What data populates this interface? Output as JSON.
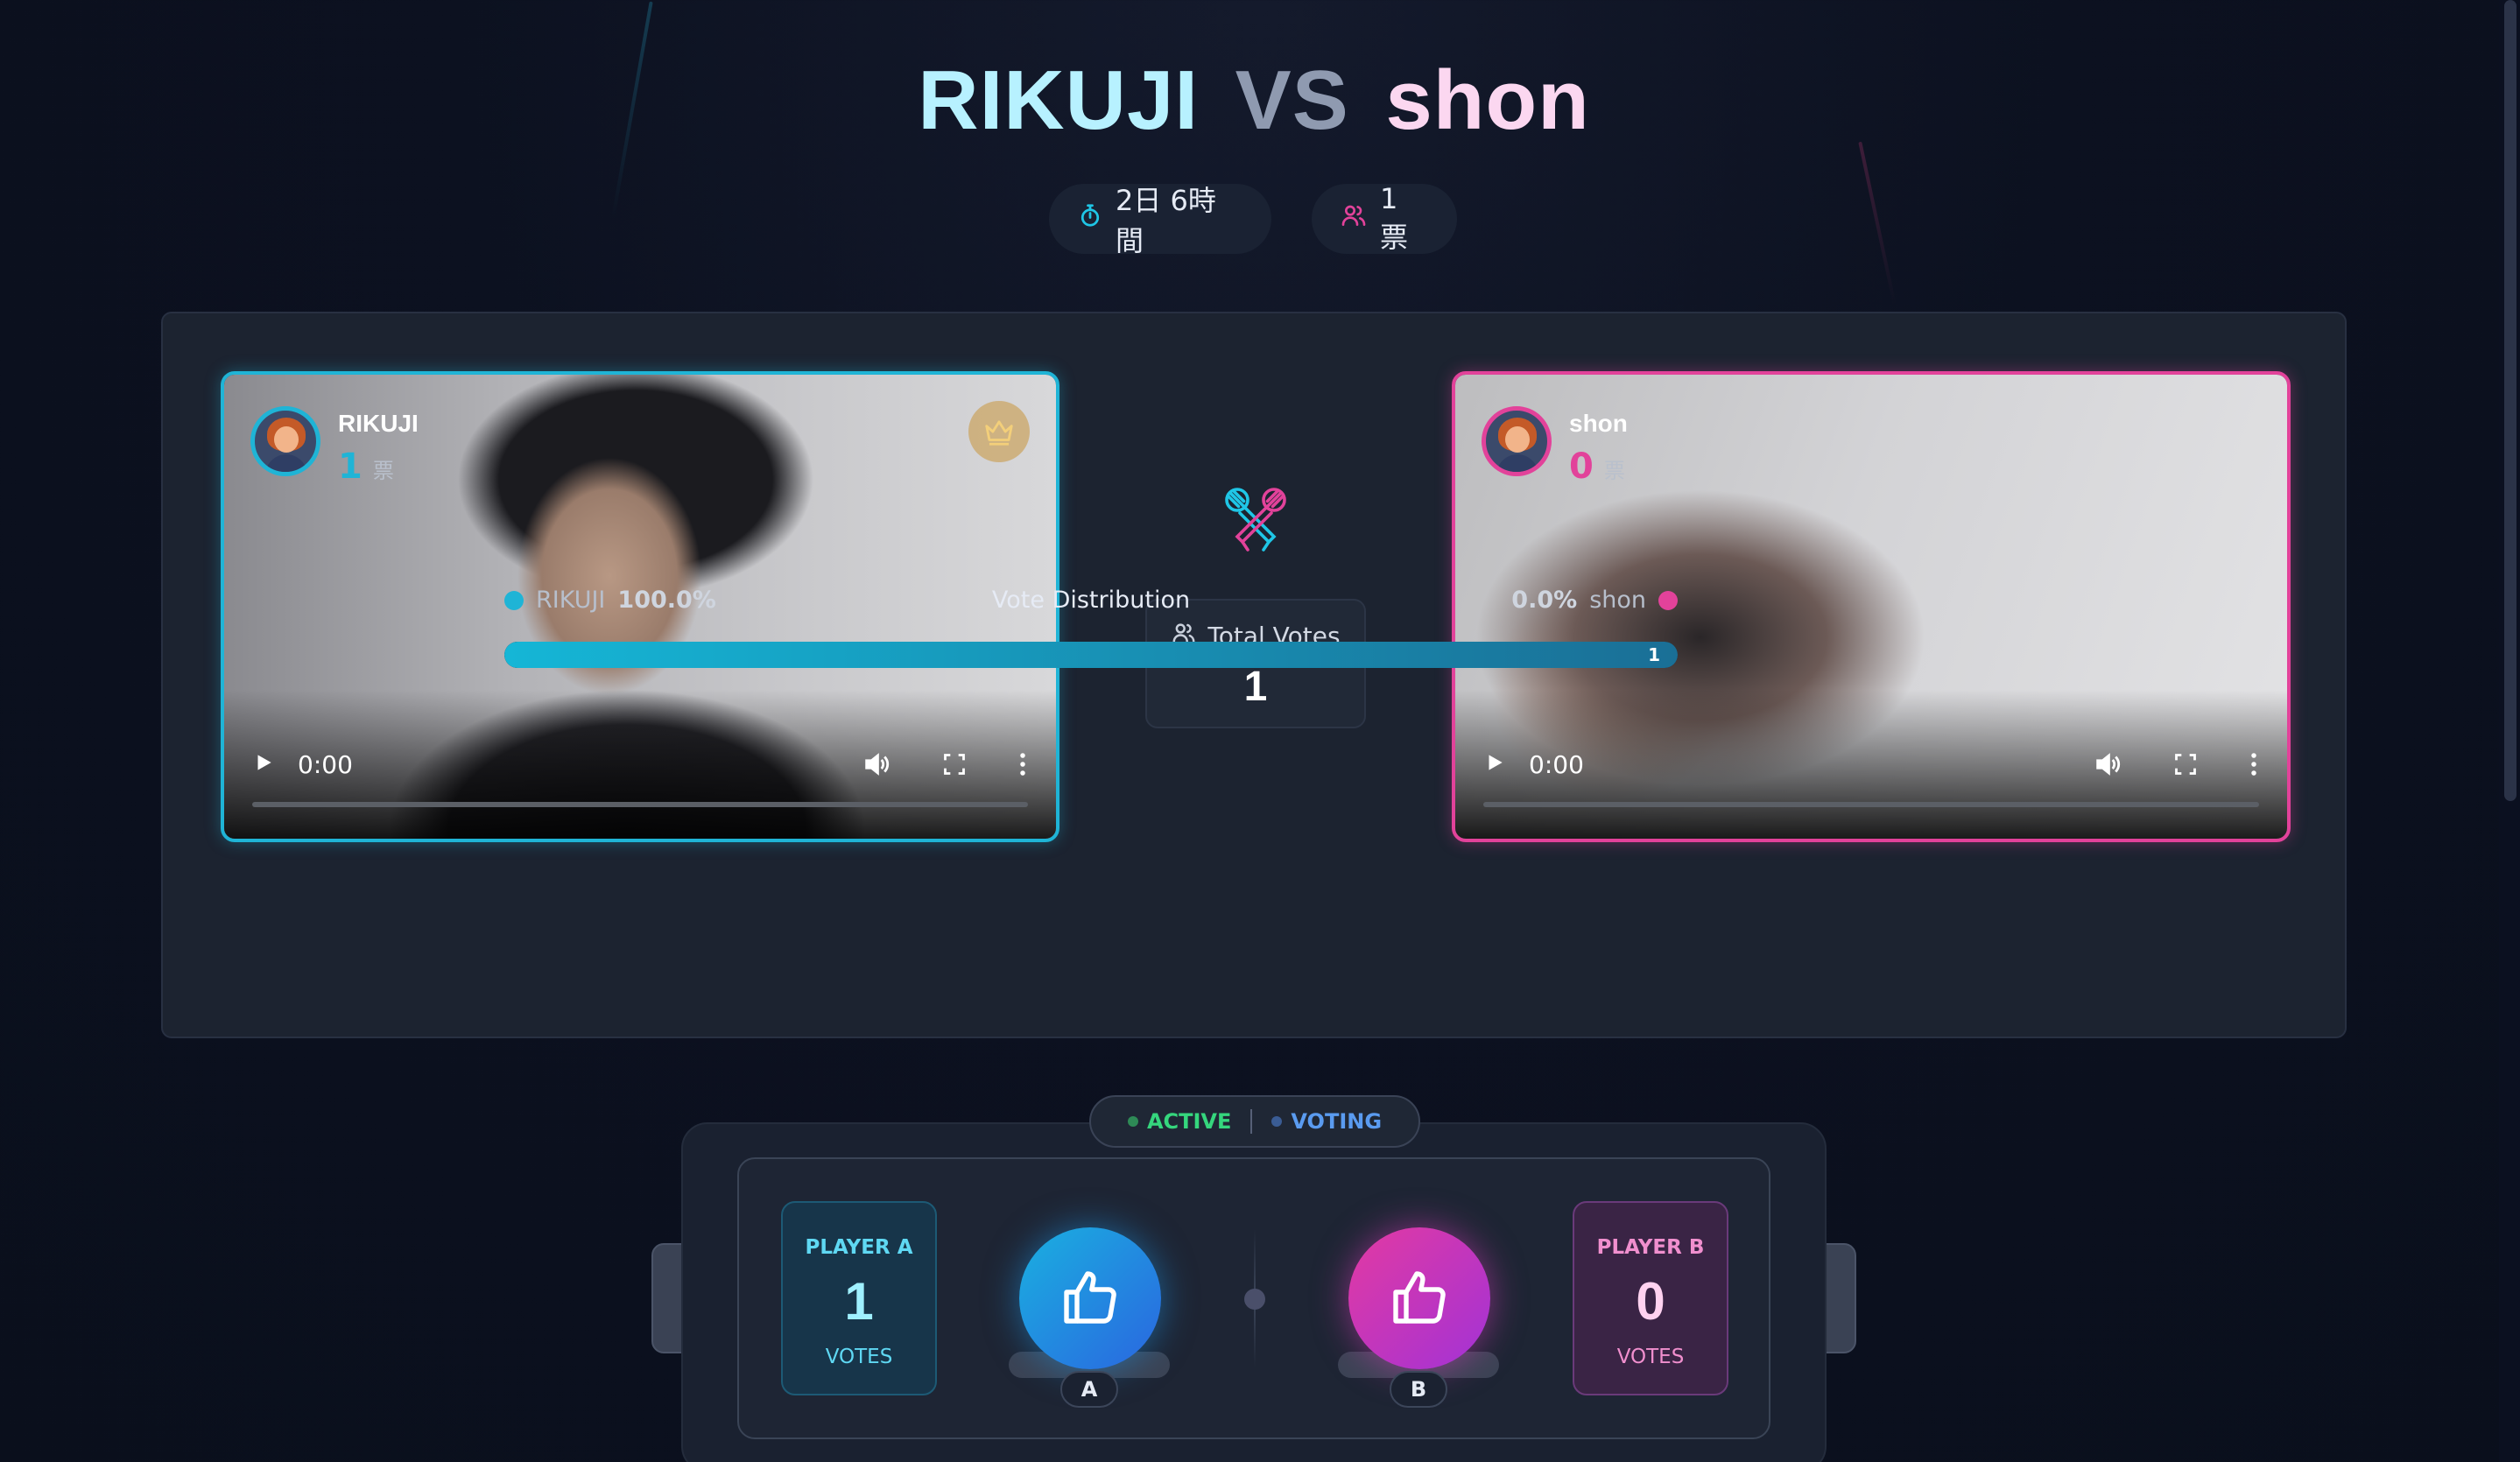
{
  "header": {
    "player_a": "RIKUJI",
    "vs": "VS",
    "player_b": "shon",
    "timer": "2日 6時間",
    "vote_count": "1 票"
  },
  "players": {
    "a": {
      "name": "RIKUJI",
      "votes": "1",
      "unit": "票",
      "video_time": "0:00"
    },
    "b": {
      "name": "shon",
      "votes": "0",
      "unit": "票",
      "video_time": "0:00"
    }
  },
  "total": {
    "label": "Total Votes",
    "value": "1"
  },
  "distribution": {
    "title": "Vote Distribution",
    "a_name": "RIKUJI",
    "a_pct": "100.0%",
    "b_name": "shon",
    "b_pct": "0.0%",
    "fill_fraction": 1.0,
    "fill_label": "1"
  },
  "status": {
    "active": "ACTIVE",
    "voting": "VOTING"
  },
  "vote_panel": {
    "a": {
      "label": "PLAYER A",
      "votes": "1",
      "unit": "VOTES",
      "tag": "A"
    },
    "b": {
      "label": "PLAYER B",
      "votes": "0",
      "unit": "VOTES",
      "tag": "B"
    }
  },
  "colors": {
    "player_a": "#1fb4d6",
    "player_b": "#e2429a",
    "active": "#35d67d",
    "voting": "#5a9bf0"
  },
  "icons": {
    "timer": "stopwatch-icon",
    "users": "users-icon",
    "center": "crossed-microphones-icon",
    "crown": "crown-icon",
    "vote": "thumbs-up-icon"
  }
}
